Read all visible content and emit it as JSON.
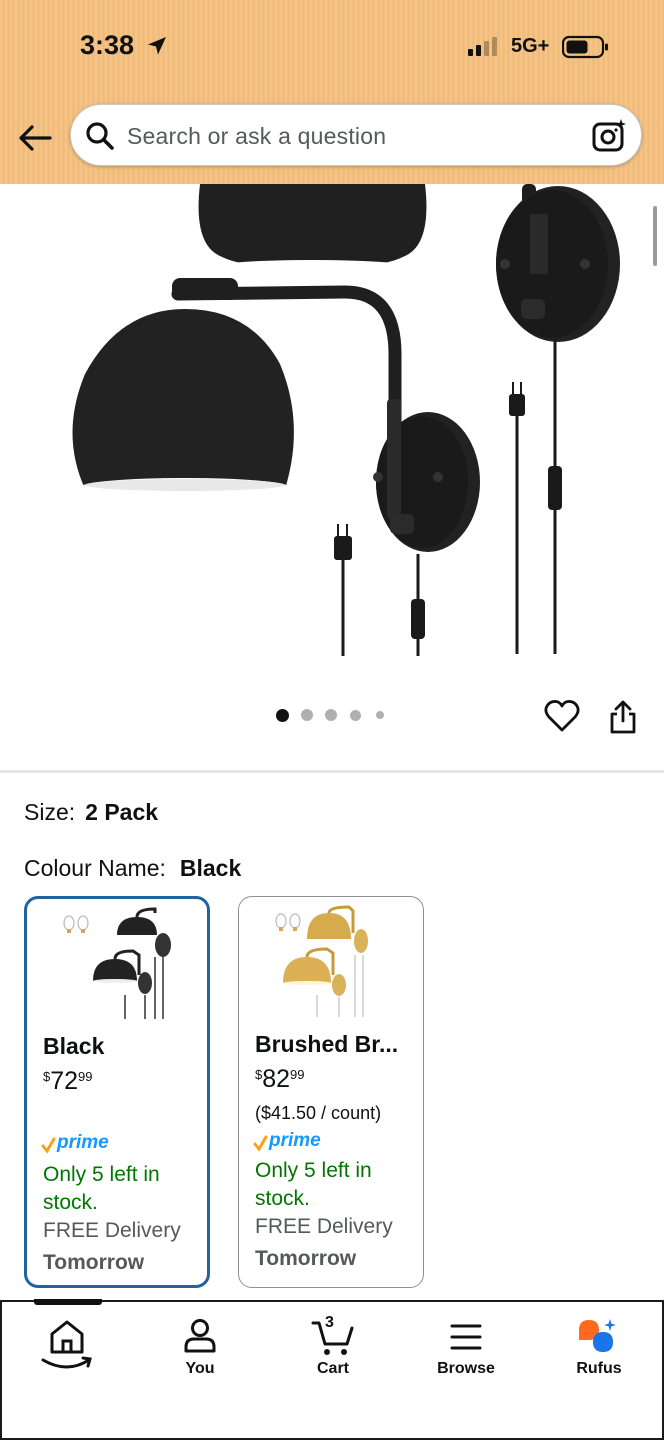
{
  "status_bar": {
    "time": "3:38",
    "network": "5G+"
  },
  "search": {
    "placeholder": "Search or ask a question"
  },
  "product": {
    "image_count": 5,
    "active_image_index": 0,
    "size_label": "Size:",
    "size_value": "2 Pack",
    "colour_label": "Colour Name:",
    "colour_value": "Black"
  },
  "swatches": [
    {
      "name": "Black",
      "price_currency": "$",
      "price_whole": "72",
      "price_fraction": "99",
      "unit_price": "",
      "prime": "prime",
      "stock": "Only 5 left in stock.",
      "delivery": "FREE Delivery",
      "delivery_day": "Tomorrow",
      "selected": true
    },
    {
      "name": "Brushed Br...",
      "price_currency": "$",
      "price_whole": "82",
      "price_fraction": "99",
      "unit_price": "($41.50 / count)",
      "prime": "prime",
      "stock": "Only 5 left in stock.",
      "delivery": "FREE Delivery",
      "delivery_day": "Tomorrow",
      "selected": false
    }
  ],
  "nav": {
    "home": "",
    "you": "You",
    "cart": "Cart",
    "cart_count": "3",
    "browse": "Browse",
    "rufus": "Rufus"
  },
  "colors": {
    "header_bg": "#f4c07e",
    "selected_border": "#2162a1",
    "stock_green": "#007600",
    "prime_blue": "#1399ff",
    "prime_check": "#f7a21b",
    "rufus_orange": "#ff6a1f",
    "rufus_blue": "#1a73e8"
  }
}
